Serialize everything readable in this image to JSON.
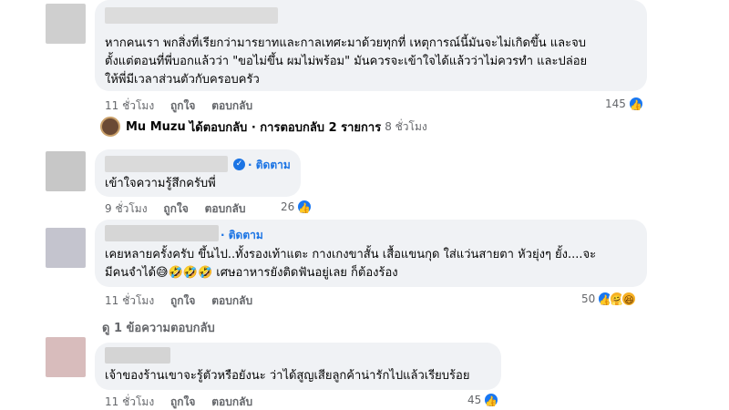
{
  "comments": [
    {
      "text_lines": [
        "หากคนเรา พกสิ่งที่เรียกว่ามารยาทและกาลเทศะมาด้วยทุกที่ เหตุการณ์นี้มันจะไม่เกิดขึ้น และจบ",
        "ตั้งแต่ตอนที่พี่บอกแล้วว่า \"ขอไม่ขึ้น ผมไม่พร้อม\" มันควรจะเข้าใจได้แล้วว่าไม่ควรทำ และปล่อย",
        "ให้พี่มีเวลาส่วนตัวกับครอบครัว"
      ],
      "time": "11 ชั่วโมง",
      "like_label": "ถูกใจ",
      "reply_label": "ตอบกลับ",
      "reaction_count": "145"
    },
    {
      "follow_label": "· ติดตาม",
      "text_lines": [
        "เข้าใจความรู้สึกครับพี่"
      ],
      "time": "9 ชั่วโมง",
      "like_label": "ถูกใจ",
      "reply_label": "ตอบกลับ",
      "reaction_count": "26"
    },
    {
      "follow_label": "· ติดตาม",
      "text_lines": [
        "เคยหลายครั้งครับ ขึ้นไป..ทั้งรองเท้าแตะ กางเกงขาสั้น เสื้อแขนกุด ใส่แว่นสายตา หัวยุ่งๆ ยั้ง....จะ",
        "มีคนจำได้😅🤣🤣🤣 เศษอาหารยังติดฟันอยู่เลย ก็ต้องร้อง"
      ],
      "time": "11 ชั่วโมง",
      "like_label": "ถูกใจ",
      "reply_label": "ตอบกลับ",
      "reaction_count": "50"
    },
    {
      "text_lines": [
        "เจ้าของร้านเขาจะรู้ตัวหรือยังนะ ว่าได้สูญเสียลูกค้าน่ารักไปแล้วเรียบร้อย"
      ],
      "time": "11 ชั่วโมง",
      "like_label": "ถูกใจ",
      "reply_label": "ตอบกลับ",
      "reaction_count": "45"
    }
  ],
  "reply_summary": {
    "author": "Mu Muzu",
    "text": "ได้ตอบกลับ · การตอบกลับ 2 รายการ",
    "time": "8 ชั่วโมง"
  },
  "view_replies_label": "ดู 1 ข้อความตอบกลับ",
  "icons": {
    "like": "like-icon",
    "haha": "haha-icon",
    "care": "care-icon",
    "verified": "verified-badge-icon"
  },
  "colors": {
    "bubble": "#f0f2f5",
    "meta_text": "#65676b",
    "link_blue": "#1b74e4",
    "like_blue": "#1877f2"
  }
}
